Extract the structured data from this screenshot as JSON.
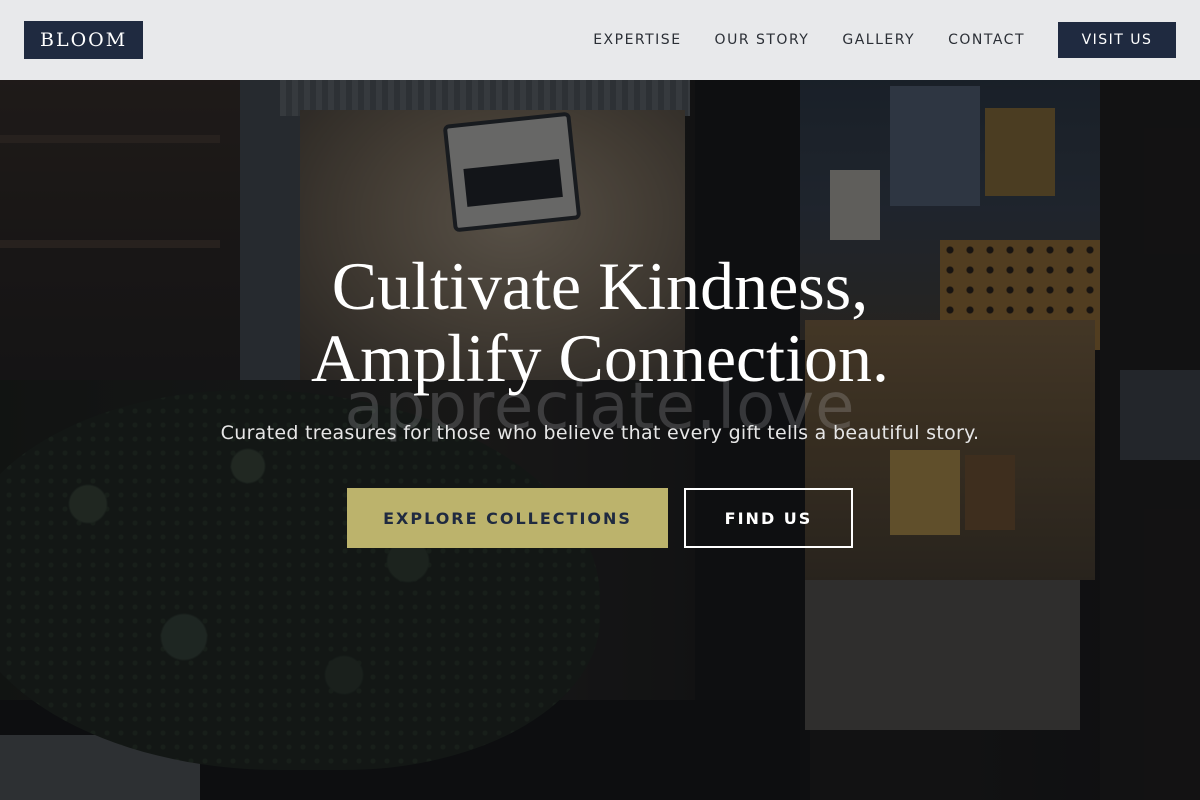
{
  "header": {
    "logo": "BLOOM",
    "nav": [
      {
        "label": "EXPERTISE"
      },
      {
        "label": "OUR STORY"
      },
      {
        "label": "GALLERY"
      },
      {
        "label": "CONTACT"
      }
    ],
    "cta_label": "VISIT US"
  },
  "hero": {
    "headline_line1": "Cultivate Kindness,",
    "headline_line2": "Amplify Connection.",
    "ghost_text": "appreciate.love",
    "tagline": "Curated treasures for those who believe that every gift tells a beautiful story.",
    "primary_cta": "EXPLORE COLLECTIONS",
    "secondary_cta": "FIND US"
  },
  "colors": {
    "navy": "#1f2a40",
    "gold": "#bcb36c",
    "header_bg": "#f0f1f3"
  }
}
